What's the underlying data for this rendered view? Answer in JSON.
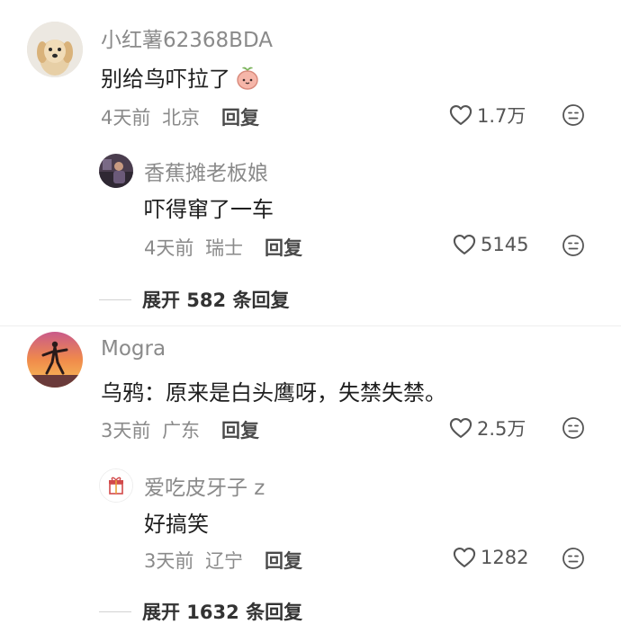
{
  "comments": [
    {
      "username": "小红薯62368BDA",
      "text": "别给鸟吓拉了",
      "emoji": "peach-emoji",
      "time": "4天前",
      "location": "北京",
      "reply_label": "回复",
      "likes": "1.7万",
      "avatar": "golden-retriever-avatar",
      "replies": [
        {
          "username": "香蕉摊老板娘",
          "text": "吓得窜了一车",
          "time": "4天前",
          "location": "瑞士",
          "reply_label": "回复",
          "likes": "5145",
          "avatar": "person-room-avatar"
        }
      ],
      "expand_label": "展开 582 条回复"
    },
    {
      "username": "Mogra",
      "text": "乌鸦：原来是白头鹰呀，失禁失禁。",
      "time": "3天前",
      "location": "广东",
      "reply_label": "回复",
      "likes": "2.5万",
      "avatar": "sunset-silhouette-avatar",
      "replies": [
        {
          "username": "爱吃皮牙子 z",
          "text": "好搞笑",
          "time": "3天前",
          "location": "辽宁",
          "reply_label": "回复",
          "likes": "1282",
          "avatar": "gift-box-avatar"
        }
      ],
      "expand_label": "展开 1632 条回复"
    }
  ],
  "colors": {
    "text_primary": "#1f1f1f",
    "text_secondary": "#8a8a8a",
    "divider": "#eeeeee"
  }
}
